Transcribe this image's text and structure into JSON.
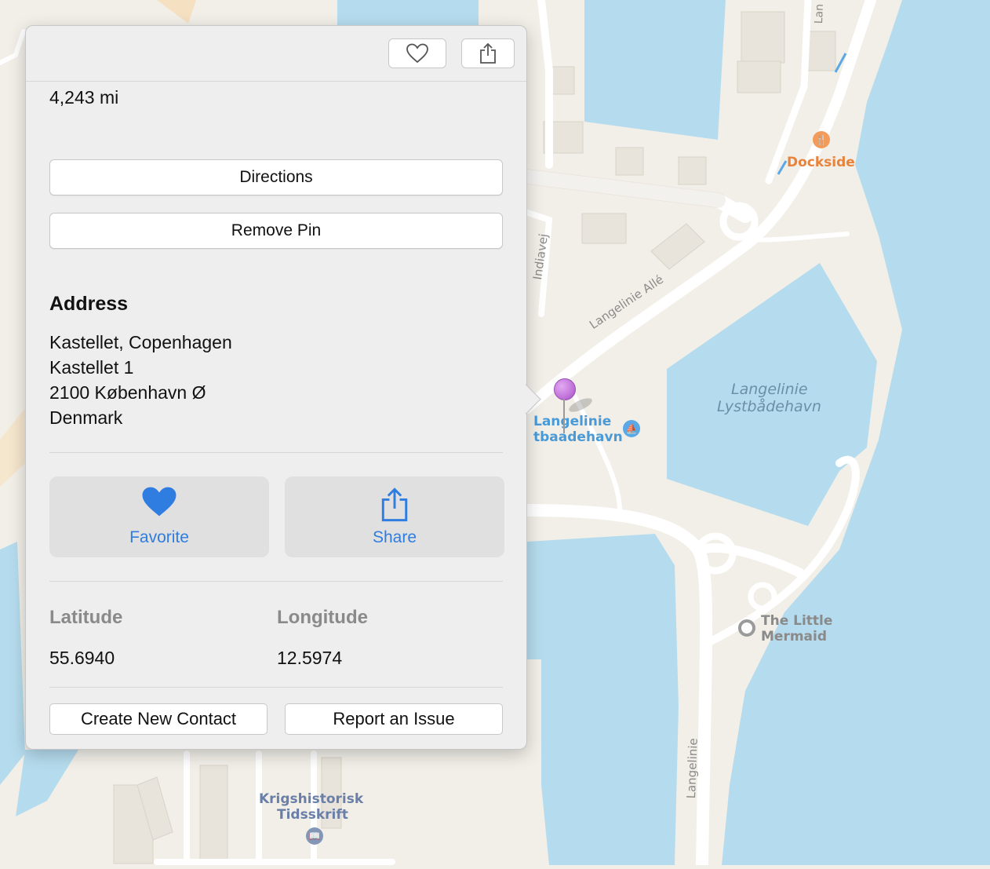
{
  "map": {
    "labels": {
      "dockside": "Dockside",
      "lystbadehavn_1": "Langelinie",
      "lystbadehavn_2": "Lystbådehavn",
      "langelinie_alle": "Langelinie Allé",
      "indiavej": "Indiavej",
      "langelinie_street": "Langelinie",
      "marina_1": "Langelinie",
      "marina_2": "tbaadehavn",
      "little_mermaid_1": "The Little",
      "little_mermaid_2": "Mermaid",
      "krigshistorisk_1": "Krigshistorisk",
      "krigshistorisk_2": "Tidsskrift",
      "top_road_fragment": "Lan"
    },
    "colors": {
      "water": "#b5dcee",
      "land": "#f2efe8",
      "road": "#ffffff",
      "pin": "#c174d9",
      "poi_blue": "#5aa9e6",
      "poi_orange": "#f29b5b",
      "label_blue": "#4a9ad8",
      "label_orange": "#e8833c",
      "label_gray": "#7c7c7c",
      "water_label": "#6c8fa8"
    }
  },
  "popover": {
    "toolbar": {
      "favorite_icon": "heart-outline-icon",
      "share_icon": "share-icon"
    },
    "distance": "4,243 mi",
    "buttons": {
      "directions": "Directions",
      "remove_pin": "Remove Pin"
    },
    "address": {
      "heading": "Address",
      "lines": [
        "Kastellet, Copenhagen",
        "Kastellet 1",
        "2100 København Ø",
        "Denmark"
      ]
    },
    "actions": [
      {
        "label": "Favorite",
        "icon": "heart-icon"
      },
      {
        "label": "Share",
        "icon": "share-icon"
      }
    ],
    "coordinates": {
      "latitude_label": "Latitude",
      "latitude": "55.6940",
      "longitude_label": "Longitude",
      "longitude": "12.5974"
    },
    "footer": {
      "create_contact": "Create New Contact",
      "report_issue": "Report an Issue"
    },
    "accent_color": "#2f7de1"
  }
}
